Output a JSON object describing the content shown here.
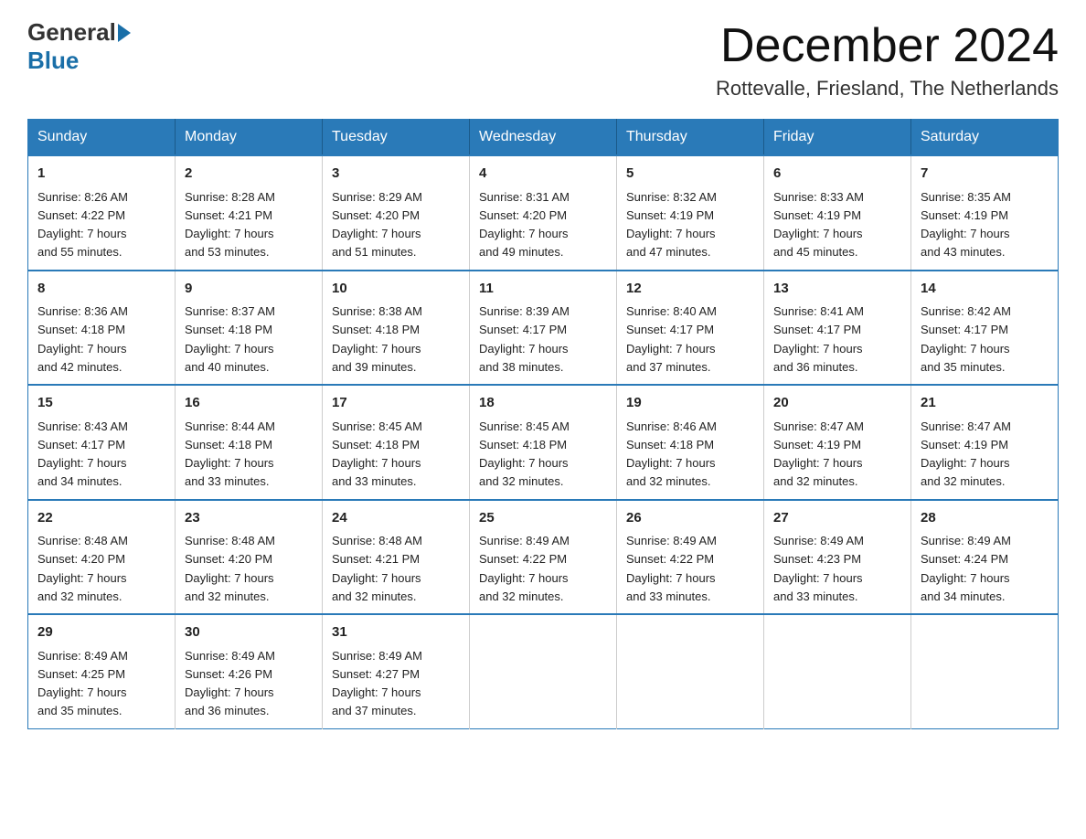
{
  "header": {
    "logo": {
      "general": "General",
      "blue": "Blue"
    },
    "title": "December 2024",
    "subtitle": "Rottevalle, Friesland, The Netherlands"
  },
  "days_of_week": [
    "Sunday",
    "Monday",
    "Tuesday",
    "Wednesday",
    "Thursday",
    "Friday",
    "Saturday"
  ],
  "weeks": [
    [
      {
        "day": "1",
        "sunrise": "8:26 AM",
        "sunset": "4:22 PM",
        "daylight": "7 hours and 55 minutes."
      },
      {
        "day": "2",
        "sunrise": "8:28 AM",
        "sunset": "4:21 PM",
        "daylight": "7 hours and 53 minutes."
      },
      {
        "day": "3",
        "sunrise": "8:29 AM",
        "sunset": "4:20 PM",
        "daylight": "7 hours and 51 minutes."
      },
      {
        "day": "4",
        "sunrise": "8:31 AM",
        "sunset": "4:20 PM",
        "daylight": "7 hours and 49 minutes."
      },
      {
        "day": "5",
        "sunrise": "8:32 AM",
        "sunset": "4:19 PM",
        "daylight": "7 hours and 47 minutes."
      },
      {
        "day": "6",
        "sunrise": "8:33 AM",
        "sunset": "4:19 PM",
        "daylight": "7 hours and 45 minutes."
      },
      {
        "day": "7",
        "sunrise": "8:35 AM",
        "sunset": "4:19 PM",
        "daylight": "7 hours and 43 minutes."
      }
    ],
    [
      {
        "day": "8",
        "sunrise": "8:36 AM",
        "sunset": "4:18 PM",
        "daylight": "7 hours and 42 minutes."
      },
      {
        "day": "9",
        "sunrise": "8:37 AM",
        "sunset": "4:18 PM",
        "daylight": "7 hours and 40 minutes."
      },
      {
        "day": "10",
        "sunrise": "8:38 AM",
        "sunset": "4:18 PM",
        "daylight": "7 hours and 39 minutes."
      },
      {
        "day": "11",
        "sunrise": "8:39 AM",
        "sunset": "4:17 PM",
        "daylight": "7 hours and 38 minutes."
      },
      {
        "day": "12",
        "sunrise": "8:40 AM",
        "sunset": "4:17 PM",
        "daylight": "7 hours and 37 minutes."
      },
      {
        "day": "13",
        "sunrise": "8:41 AM",
        "sunset": "4:17 PM",
        "daylight": "7 hours and 36 minutes."
      },
      {
        "day": "14",
        "sunrise": "8:42 AM",
        "sunset": "4:17 PM",
        "daylight": "7 hours and 35 minutes."
      }
    ],
    [
      {
        "day": "15",
        "sunrise": "8:43 AM",
        "sunset": "4:17 PM",
        "daylight": "7 hours and 34 minutes."
      },
      {
        "day": "16",
        "sunrise": "8:44 AM",
        "sunset": "4:18 PM",
        "daylight": "7 hours and 33 minutes."
      },
      {
        "day": "17",
        "sunrise": "8:45 AM",
        "sunset": "4:18 PM",
        "daylight": "7 hours and 33 minutes."
      },
      {
        "day": "18",
        "sunrise": "8:45 AM",
        "sunset": "4:18 PM",
        "daylight": "7 hours and 32 minutes."
      },
      {
        "day": "19",
        "sunrise": "8:46 AM",
        "sunset": "4:18 PM",
        "daylight": "7 hours and 32 minutes."
      },
      {
        "day": "20",
        "sunrise": "8:47 AM",
        "sunset": "4:19 PM",
        "daylight": "7 hours and 32 minutes."
      },
      {
        "day": "21",
        "sunrise": "8:47 AM",
        "sunset": "4:19 PM",
        "daylight": "7 hours and 32 minutes."
      }
    ],
    [
      {
        "day": "22",
        "sunrise": "8:48 AM",
        "sunset": "4:20 PM",
        "daylight": "7 hours and 32 minutes."
      },
      {
        "day": "23",
        "sunrise": "8:48 AM",
        "sunset": "4:20 PM",
        "daylight": "7 hours and 32 minutes."
      },
      {
        "day": "24",
        "sunrise": "8:48 AM",
        "sunset": "4:21 PM",
        "daylight": "7 hours and 32 minutes."
      },
      {
        "day": "25",
        "sunrise": "8:49 AM",
        "sunset": "4:22 PM",
        "daylight": "7 hours and 32 minutes."
      },
      {
        "day": "26",
        "sunrise": "8:49 AM",
        "sunset": "4:22 PM",
        "daylight": "7 hours and 33 minutes."
      },
      {
        "day": "27",
        "sunrise": "8:49 AM",
        "sunset": "4:23 PM",
        "daylight": "7 hours and 33 minutes."
      },
      {
        "day": "28",
        "sunrise": "8:49 AM",
        "sunset": "4:24 PM",
        "daylight": "7 hours and 34 minutes."
      }
    ],
    [
      {
        "day": "29",
        "sunrise": "8:49 AM",
        "sunset": "4:25 PM",
        "daylight": "7 hours and 35 minutes."
      },
      {
        "day": "30",
        "sunrise": "8:49 AM",
        "sunset": "4:26 PM",
        "daylight": "7 hours and 36 minutes."
      },
      {
        "day": "31",
        "sunrise": "8:49 AM",
        "sunset": "4:27 PM",
        "daylight": "7 hours and 37 minutes."
      },
      null,
      null,
      null,
      null
    ]
  ]
}
